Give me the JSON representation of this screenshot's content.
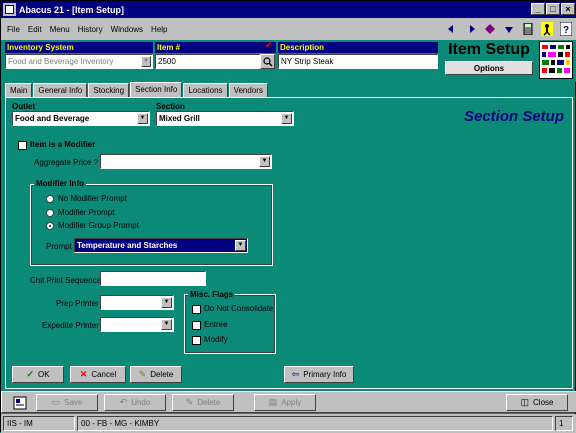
{
  "window": {
    "title": "Abacus 21 - [Item Setup]"
  },
  "menu": [
    "File",
    "Edit",
    "Menu",
    "History",
    "Windows",
    "Help"
  ],
  "header": {
    "inventory_label": "Inventory System",
    "inventory_value": "Food and Beverage Inventory",
    "item_label": "Item #",
    "item_value": "2500",
    "description_label": "Description",
    "description_value": "NY Strip Steak",
    "page_title": "Item Setup",
    "options_label": "Options"
  },
  "tabs": [
    "Main",
    "General Info",
    "Stocking",
    "Section Info",
    "Locations",
    "Vendors"
  ],
  "active_tab": "Section Info",
  "section": {
    "outlet_label": "Outlet",
    "outlet_value": "Food and Beverage",
    "section_label": "Section",
    "section_value": "Mixed Grill",
    "title": "Section Setup",
    "modifier_check_label": "Item is a Modifier",
    "aggregate_label": "Aggregate Price ?",
    "aggregate_value": "",
    "modifier_info_label": "Modifier Info",
    "radio_options": [
      "No Modifier Prompt",
      "Modifier Prompt",
      "Modifier Group Prompt"
    ],
    "selected_radio": "Modifier Group Prompt",
    "prompt_label": "Prompt",
    "prompt_value": "Temperature and Starches",
    "chit_label": "Chit Print Sequence",
    "chit_value": "",
    "prep_printer_label": "Prep Printer",
    "prep_printer_value": "",
    "expedite_printer_label": "Expedite Printer",
    "expedite_printer_value": "",
    "misc_flags_label": "Misc. Flags",
    "misc_flags": [
      "Do Not Consolidate",
      "Entree",
      "Modify"
    ]
  },
  "actions": {
    "ok": "OK",
    "cancel": "Cancel",
    "delete": "Delete",
    "primary_info": "Primary Info"
  },
  "toolbar": {
    "save": "Save",
    "undo": "Undo",
    "delete": "Delete",
    "apply": "Apply",
    "close": "Close"
  },
  "status": {
    "left": "IIS - IM",
    "middle": "00 - FB - MG - KIMBY",
    "right": "1"
  },
  "colors": {
    "background": "#0c8a78",
    "title_bar": "#000080",
    "label_yellow": "#ffff00",
    "section_title": "#000080"
  }
}
